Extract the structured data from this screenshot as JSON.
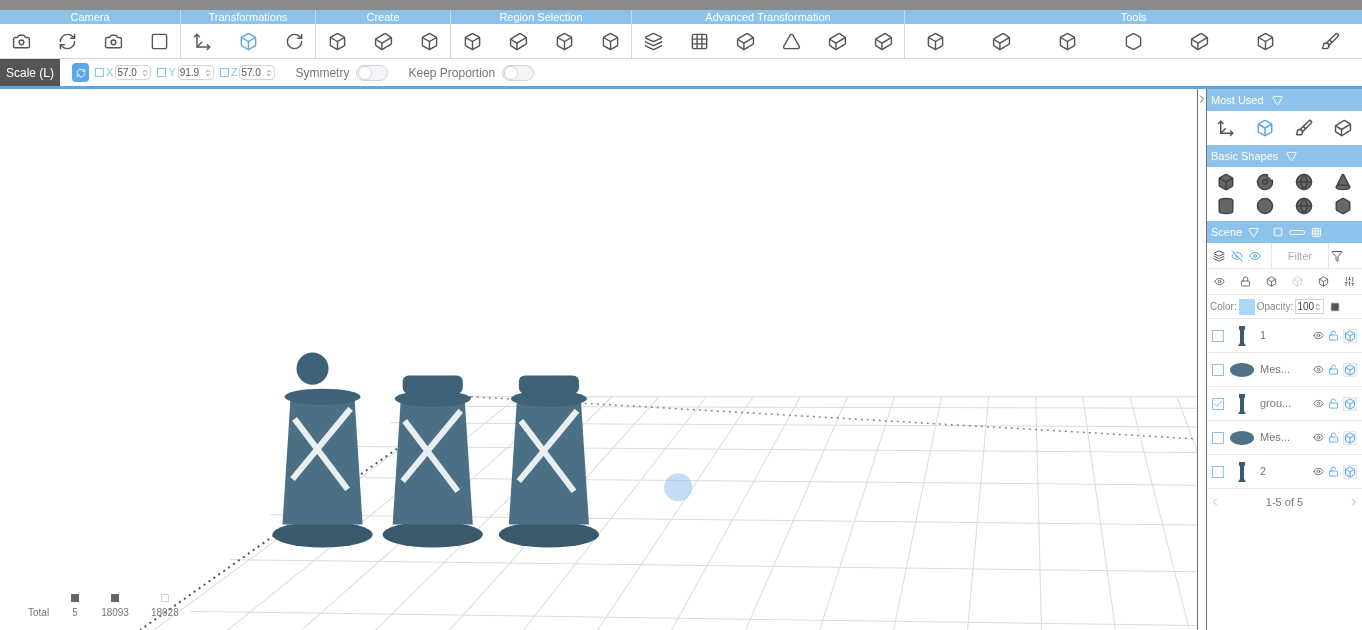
{
  "toolbar": {
    "groups": [
      {
        "label": "Camera",
        "tools": [
          {
            "selected": false
          },
          {
            "selected": false
          },
          {
            "selected": false
          },
          {
            "selected": false
          }
        ]
      },
      {
        "label": "Transformations",
        "tools": [
          {
            "selected": false
          },
          {
            "selected": true
          },
          {
            "selected": false
          }
        ]
      },
      {
        "label": "Create",
        "tools": [
          {
            "selected": false
          },
          {
            "selected": false
          },
          {
            "selected": false
          }
        ]
      },
      {
        "label": "Region Selection",
        "tools": [
          {
            "selected": false
          },
          {
            "selected": false
          },
          {
            "selected": false
          },
          {
            "selected": false
          }
        ]
      },
      {
        "label": "Advanced Transformation",
        "tools": [
          {
            "selected": false
          },
          {
            "selected": false
          },
          {
            "selected": false
          },
          {
            "selected": false
          },
          {
            "selected": false
          },
          {
            "selected": false
          }
        ]
      },
      {
        "label": "Tools",
        "tools": [
          {
            "selected": false
          },
          {
            "selected": false
          },
          {
            "selected": false
          },
          {
            "selected": false
          },
          {
            "selected": false
          },
          {
            "selected": false
          },
          {
            "selected": false
          }
        ]
      }
    ]
  },
  "scale_bar": {
    "label": "Scale (L)",
    "axes": [
      {
        "label": "X",
        "checked": false,
        "value": "57.0"
      },
      {
        "label": "Y",
        "checked": false,
        "value": "91.9"
      },
      {
        "label": "Z",
        "checked": false,
        "value": "57.0"
      }
    ],
    "toggles": [
      {
        "label": "Symmetry",
        "on": false
      },
      {
        "label": "Keep Proportion",
        "on": false
      }
    ]
  },
  "stats": {
    "label": "Total",
    "values": [
      "5",
      "18093",
      "18028"
    ]
  },
  "panel": {
    "most_used": {
      "title": "Most Used",
      "tools": [
        {
          "selected": false
        },
        {
          "selected": true
        },
        {
          "selected": false
        },
        {
          "selected": false
        }
      ]
    },
    "basic_shapes": {
      "title": "Basic Shapes",
      "shapes": [
        {
          "selected": false
        },
        {
          "selected": false
        },
        {
          "selected": false
        },
        {
          "selected": false
        },
        {
          "selected": false
        },
        {
          "selected": false
        },
        {
          "selected": false
        },
        {
          "selected": false
        }
      ]
    },
    "scene": {
      "title": "Scene",
      "filter_placeholder": "Filter",
      "color_label": "Color:",
      "color": "#a8d8f8",
      "opacity_label": "Opacity:",
      "opacity": "100",
      "items": [
        {
          "name": "1",
          "kind": "piece",
          "checked": false
        },
        {
          "name": "Mes...",
          "kind": "disc",
          "checked": false
        },
        {
          "name": "grou...",
          "kind": "piece",
          "checked": true
        },
        {
          "name": "Mes...",
          "kind": "disc",
          "checked": false
        },
        {
          "name": "2",
          "kind": "piece",
          "checked": false
        }
      ],
      "pagination": "1-5 of 5"
    }
  }
}
